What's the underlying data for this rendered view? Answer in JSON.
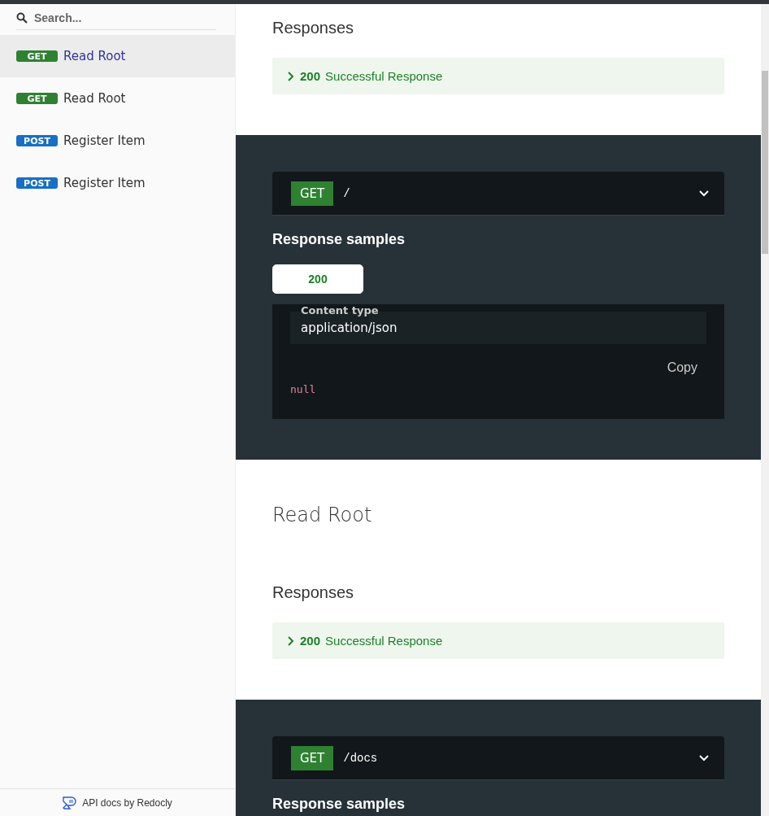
{
  "sidebar": {
    "search": {
      "placeholder": "Search..."
    },
    "items": [
      {
        "method": "GET",
        "label": "Read Root",
        "selected": true
      },
      {
        "method": "GET",
        "label": "Read Root",
        "selected": false
      },
      {
        "method": "POST",
        "label": "Register Item",
        "selected": false
      },
      {
        "method": "POST",
        "label": "Register Item",
        "selected": false
      }
    ],
    "footer": "API docs by Redocly"
  },
  "sections": [
    {
      "kind": "operation",
      "responses_heading": "Responses",
      "response": {
        "code": "200",
        "text": "Successful Response"
      }
    },
    {
      "kind": "samples",
      "endpoint": {
        "method": "GET",
        "path": "/"
      },
      "heading": "Response samples",
      "tabs": [
        {
          "label": "200",
          "selected": true
        }
      ],
      "content_type_label": "Content type",
      "content_type": "application/json",
      "copy": "Copy",
      "code": "null"
    },
    {
      "kind": "operation",
      "title": "Read Root",
      "responses_heading": "Responses",
      "response": {
        "code": "200",
        "text": "Successful Response"
      }
    },
    {
      "kind": "samples",
      "endpoint": {
        "method": "GET",
        "path": "/docs"
      },
      "heading": "Response samples"
    }
  ]
}
